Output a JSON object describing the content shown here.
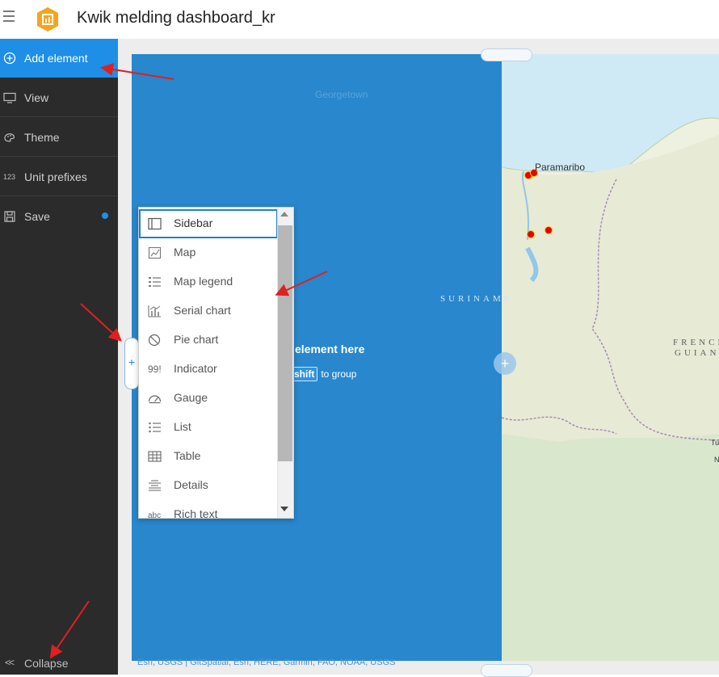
{
  "header": {
    "title": "Kwik melding dashboard_kr",
    "menu_icon": "hamburger-menu-icon",
    "logo_icon": "dashboard-app-logo"
  },
  "sidebar": {
    "items": [
      {
        "label": "Add element",
        "icon": "plus-circle-icon",
        "active": true
      },
      {
        "label": "View",
        "icon": "monitor-icon"
      },
      {
        "label": "Theme",
        "icon": "palette-icon"
      },
      {
        "label": "Unit prefixes",
        "icon": "numbers-icon",
        "icon_text": "123"
      },
      {
        "label": "Save",
        "icon": "save-icon",
        "unsaved": true
      }
    ],
    "collapse": {
      "label": "Collapse",
      "icon_text": "<<"
    }
  },
  "colors": {
    "accent": "#1f8ee6",
    "sidebar_bg": "#2b2b2b",
    "overlay": "#1f82cc",
    "marker": "#e60000"
  },
  "map": {
    "labels": {
      "georgetown": "Georgetown",
      "paramaribo": "Paramaribo",
      "suriname": "SURINAME",
      "french_guiana_1": "FRENCH",
      "french_guiana_2": "GUIANA",
      "cut_1": "Tu",
      "cut_2": "N"
    },
    "attribution": "Esri, USGS | GitSpatial, Esri, HERE, Garmin, FAO, NOAA, USGS"
  },
  "drop_zone": {
    "text": "element here",
    "shift_key": "shift",
    "shift_text": "to group"
  },
  "element_menu": {
    "items": [
      {
        "label": "Sidebar",
        "icon": "sidebar-icon",
        "selected": true
      },
      {
        "label": "Map",
        "icon": "map-icon"
      },
      {
        "label": "Map legend",
        "icon": "map-legend-icon"
      },
      {
        "label": "Serial chart",
        "icon": "serial-chart-icon"
      },
      {
        "label": "Pie chart",
        "icon": "pie-chart-icon"
      },
      {
        "label": "Indicator",
        "icon": "indicator-icon",
        "icon_text": "99!"
      },
      {
        "label": "Gauge",
        "icon": "gauge-icon"
      },
      {
        "label": "List",
        "icon": "list-icon"
      },
      {
        "label": "Table",
        "icon": "table-icon"
      },
      {
        "label": "Details",
        "icon": "details-icon"
      },
      {
        "label": "Rich text",
        "icon": "rich-text-icon",
        "icon_text": "abc"
      }
    ]
  }
}
